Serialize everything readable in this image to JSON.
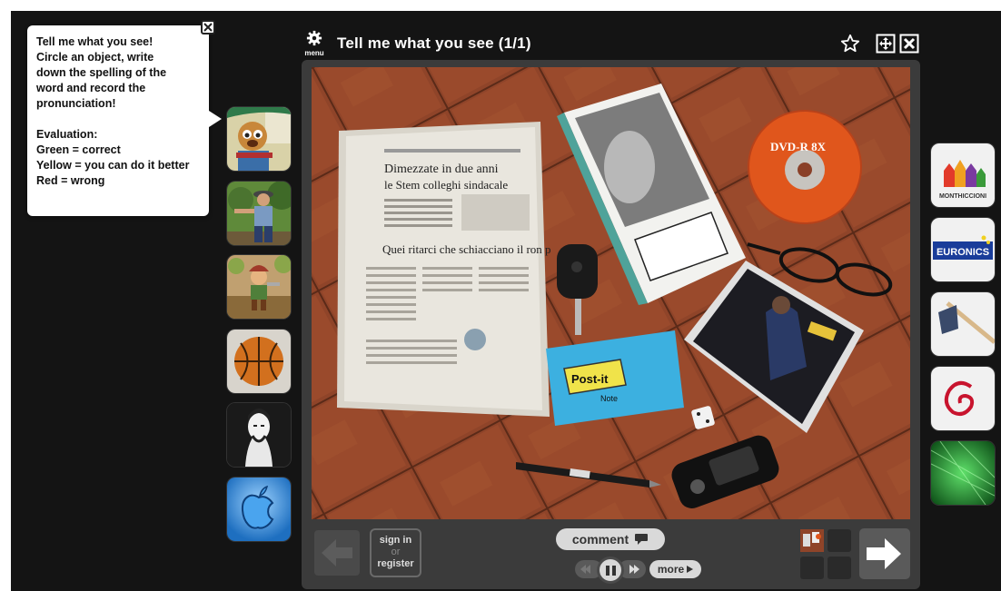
{
  "header": {
    "menu_label": "menu",
    "title": "Tell me what you see (1/1)"
  },
  "tooltip": {
    "lines": [
      "Tell me what you see!",
      "Circle an object, write",
      "down the spelling of the",
      "word and record the",
      "pronunciation!",
      "",
      "Evaluation:",
      "Green = correct",
      "Yellow = you can do it better",
      "Red = wrong"
    ]
  },
  "photo": {
    "newspaper_headline_1": "Dimezzate in due anni",
    "newspaper_headline_2": "le Stem colleghi sindacale",
    "newspaper_headline_3": "Quei ritarci che schiacciano il ron p",
    "dvd_label": "DVD-R 8X",
    "postit_label": "Post-it",
    "postit_sub": "Note"
  },
  "sponsors": {
    "euronics": "EURONICS",
    "monthiccioni": "MONTHICCIONI"
  },
  "controls": {
    "signin_line1": "sign in",
    "signin_line2": "or",
    "signin_line3": "register",
    "comment_label": "comment",
    "more_label": "more"
  },
  "colors": {
    "background": "#141414",
    "panel": "#3b3b3b",
    "tooltip": "#ffffff",
    "floor": "#8a3f28"
  }
}
